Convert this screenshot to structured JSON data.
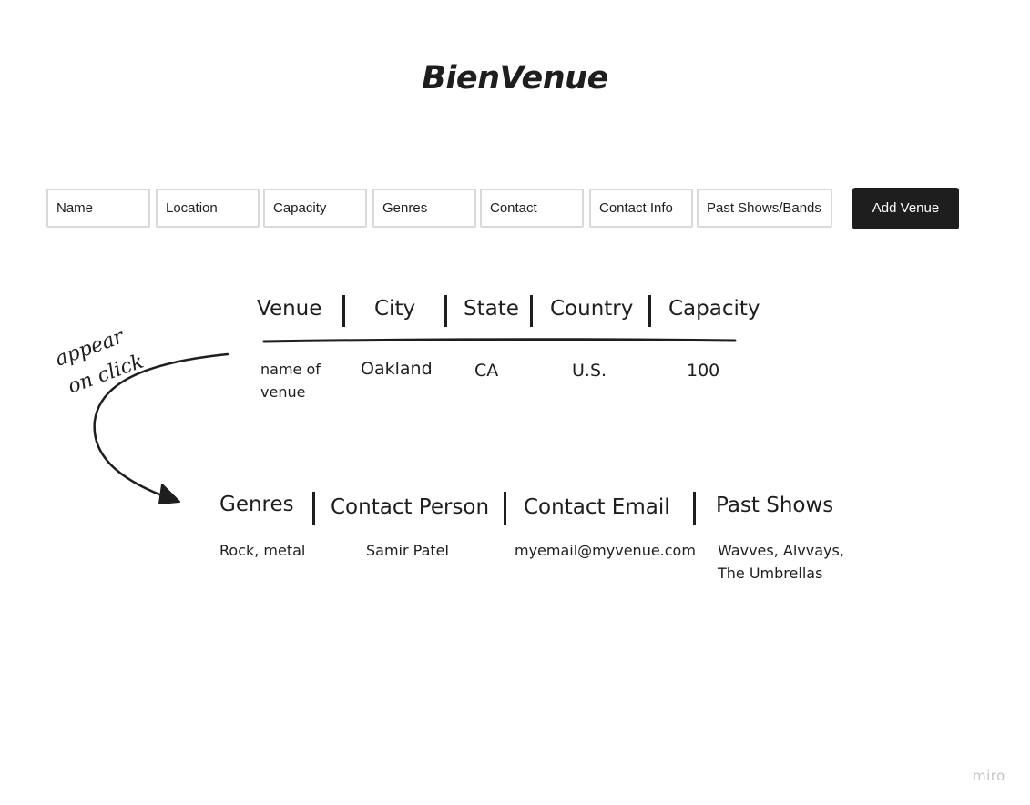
{
  "app_title": "BienVenue",
  "form": {
    "fields": [
      {
        "placeholder": "Name"
      },
      {
        "placeholder": "Location"
      },
      {
        "placeholder": "Capacity"
      },
      {
        "placeholder": "Genres"
      },
      {
        "placeholder": "Contact"
      },
      {
        "placeholder": "Contact Info"
      },
      {
        "placeholder": "Past Shows/Bands"
      }
    ],
    "submit_label": "Add Venue"
  },
  "venue_table": {
    "headers": [
      "Venue",
      "City",
      "State",
      "Country",
      "Capacity"
    ],
    "row": {
      "venue": "name of venue",
      "city": "Oakland",
      "state": "CA",
      "country": "U.S.",
      "capacity": "100"
    }
  },
  "annotation": {
    "line1": "appear",
    "line2": "on click"
  },
  "details_table": {
    "headers": [
      "Genres",
      "Contact Person",
      "Contact Email",
      "Past Shows"
    ],
    "row": {
      "genres": "Rock, metal",
      "contact_person": "Samir Patel",
      "contact_email": "myemail@myvenue.com",
      "past_shows": "Wavves, Alvvays, The Umbrellas"
    }
  },
  "watermark": "miro"
}
